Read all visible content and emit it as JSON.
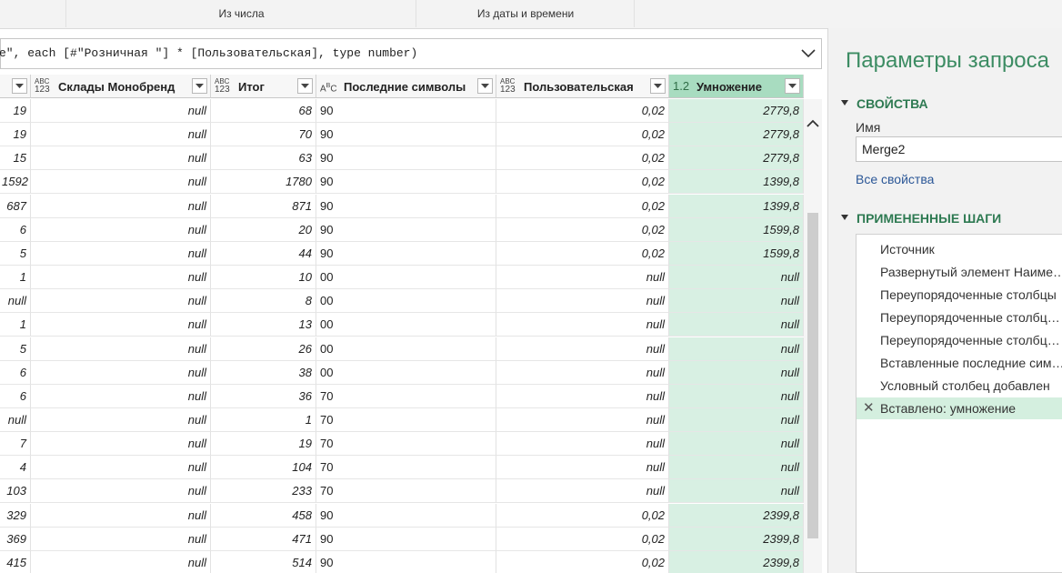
{
  "ribbon": {
    "groups": [
      "Из числа",
      "Из даты и времени"
    ]
  },
  "formula": {
    "text": "e\", each [#\"Розничная \"] * [Пользовательская], type number)"
  },
  "columns": [
    {
      "label": "",
      "type": ""
    },
    {
      "label": "Склады Монобренд",
      "type": "ABC123"
    },
    {
      "label": "Итог",
      "type": "ABC123"
    },
    {
      "label": "Последние символы",
      "type": "ABC"
    },
    {
      "label": "Пользовательская",
      "type": "ABC123"
    },
    {
      "label": "Умножение",
      "type": "1.2"
    }
  ],
  "rows": [
    [
      "19",
      "null",
      "68",
      "90",
      "0,02",
      "2779,8"
    ],
    [
      "19",
      "null",
      "70",
      "90",
      "0,02",
      "2779,8"
    ],
    [
      "15",
      "null",
      "63",
      "90",
      "0,02",
      "2779,8"
    ],
    [
      "1592",
      "null",
      "1780",
      "90",
      "0,02",
      "1399,8"
    ],
    [
      "687",
      "null",
      "871",
      "90",
      "0,02",
      "1399,8"
    ],
    [
      "6",
      "null",
      "20",
      "90",
      "0,02",
      "1599,8"
    ],
    [
      "5",
      "null",
      "44",
      "90",
      "0,02",
      "1599,8"
    ],
    [
      "1",
      "null",
      "10",
      "00",
      "null",
      "null"
    ],
    [
      "null",
      "null",
      "8",
      "00",
      "null",
      "null"
    ],
    [
      "1",
      "null",
      "13",
      "00",
      "null",
      "null"
    ],
    [
      "5",
      "null",
      "26",
      "00",
      "null",
      "null"
    ],
    [
      "6",
      "null",
      "38",
      "00",
      "null",
      "null"
    ],
    [
      "6",
      "null",
      "36",
      "70",
      "null",
      "null"
    ],
    [
      "null",
      "null",
      "1",
      "70",
      "null",
      "null"
    ],
    [
      "7",
      "null",
      "19",
      "70",
      "null",
      "null"
    ],
    [
      "4",
      "null",
      "104",
      "70",
      "null",
      "null"
    ],
    [
      "103",
      "null",
      "233",
      "70",
      "null",
      "null"
    ],
    [
      "329",
      "null",
      "458",
      "90",
      "0,02",
      "2399,8"
    ],
    [
      "369",
      "null",
      "471",
      "90",
      "0,02",
      "2399,8"
    ],
    [
      "415",
      "null",
      "514",
      "90",
      "0,02",
      "2399,8"
    ]
  ],
  "panel": {
    "title": "Параметры запроса",
    "properties_heading": "СВОЙСТВА",
    "name_label": "Имя",
    "name_value": "Merge2",
    "all_properties": "Все свойства",
    "steps_heading": "ПРИМЕНЕННЫЕ ШАГИ",
    "steps": [
      "Источник",
      "Развернутый элемент Наиме…",
      "Переупорядоченные столбцы",
      "Переупорядоченные столбц…",
      "Переупорядоченные столбц…",
      "Вставленные последние сим…",
      "Условный столбец добавлен",
      "Вставлено: умножение"
    ],
    "active_step": 7
  },
  "colors": {
    "accent": "#3c8c63",
    "selected_header": "#a8dcc0",
    "selected_cells": "#d8f0e3",
    "link": "#2b5797"
  }
}
